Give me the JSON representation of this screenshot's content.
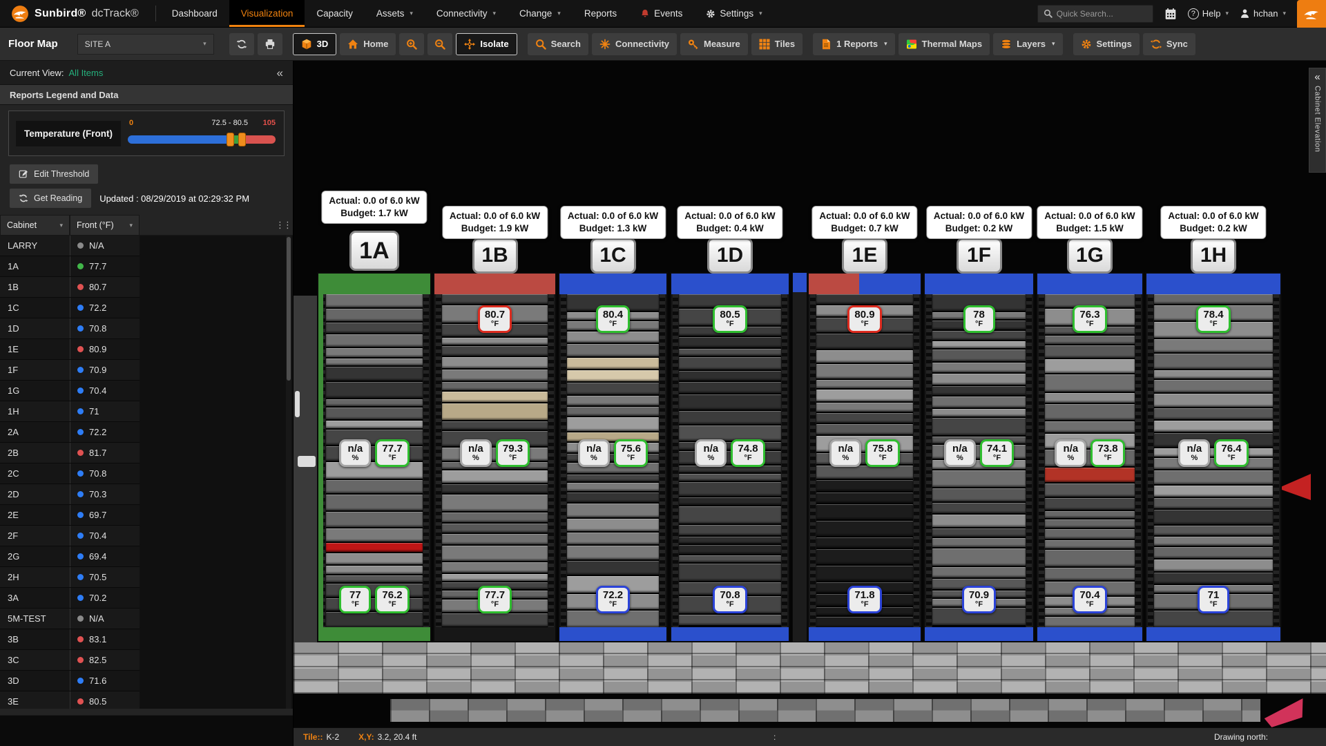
{
  "navbar": {
    "brand": {
      "name": "Sunbird®",
      "product": "dcTrack®"
    },
    "items": [
      {
        "label": "Dashboard"
      },
      {
        "label": "Visualization",
        "active": true
      },
      {
        "label": "Capacity"
      },
      {
        "label": "Assets",
        "dropdown": true
      },
      {
        "label": "Connectivity",
        "dropdown": true
      },
      {
        "label": "Change",
        "dropdown": true
      },
      {
        "label": "Reports"
      },
      {
        "label": "Events",
        "icon": "bell"
      },
      {
        "label": "Settings",
        "icon": "gear",
        "dropdown": true
      }
    ],
    "search_placeholder": "Quick Search...",
    "help_label": "Help",
    "user_name": "hchan"
  },
  "toolbar": {
    "title": "Floor Map",
    "site_selector": "SITE A",
    "buttons": [
      {
        "name": "refresh-button",
        "icon": "refresh",
        "icon_color": "#d8d8d8"
      },
      {
        "name": "print-button",
        "icon": "printer",
        "icon_color": "#d8d8d8"
      },
      {
        "name": "view-3d-button",
        "icon": "cube",
        "label": "3D",
        "outlined": true,
        "gap_before": true
      },
      {
        "name": "home-button",
        "icon": "home",
        "label": "Home"
      },
      {
        "name": "zoom-in-button",
        "icon": "zoom-in"
      },
      {
        "name": "zoom-out-button",
        "icon": "zoom-out"
      },
      {
        "name": "isolate-button",
        "icon": "isolate",
        "label": "Isolate",
        "outlined": true
      },
      {
        "name": "search-button",
        "icon": "search",
        "label": "Search",
        "gap_before": true
      },
      {
        "name": "connectivity-button",
        "icon": "connectivity",
        "label": "Connectivity"
      },
      {
        "name": "measure-button",
        "icon": "measure",
        "label": "Measure"
      },
      {
        "name": "tiles-button",
        "icon": "tiles",
        "label": "Tiles"
      },
      {
        "name": "reports-button",
        "icon": "report",
        "label": "1 Reports",
        "dropdown": true,
        "gap_before": true
      },
      {
        "name": "thermal-maps-button",
        "icon": "thermal",
        "label": "Thermal Maps"
      },
      {
        "name": "layers-button",
        "icon": "layers",
        "label": "Layers",
        "dropdown": true
      },
      {
        "name": "settings-button",
        "icon": "gear",
        "label": "Settings",
        "gap_before": true
      },
      {
        "name": "sync-button",
        "icon": "sync",
        "label": "Sync"
      }
    ]
  },
  "sidebar": {
    "current_view_label": "Current View:",
    "current_view_value": "All Items",
    "legend_header": "Reports Legend and Data",
    "legend": {
      "metric_label": "Temperature (Front)",
      "min": "0",
      "max": "105",
      "range": "72.5 - 80.5",
      "low_pct": 69,
      "mid_pct": 77,
      "colors": {
        "low": "#2d6fd9",
        "mid": "#3da03d",
        "high": "#d9534f",
        "handle": "#ef8d1d"
      }
    },
    "edit_threshold_label": "Edit Threshold",
    "get_reading_label": "Get Reading",
    "updated_text": "Updated : 08/29/2019 at 02:29:32 PM",
    "table": {
      "columns": [
        "Cabinet",
        "Front (°F)"
      ],
      "rows": [
        {
          "cabinet": "LARRY",
          "value": "N/A",
          "status": "na"
        },
        {
          "cabinet": "1A",
          "value": "77.7",
          "status": "ok"
        },
        {
          "cabinet": "1B",
          "value": "80.7",
          "status": "hot"
        },
        {
          "cabinet": "1C",
          "value": "72.2",
          "status": "cold"
        },
        {
          "cabinet": "1D",
          "value": "70.8",
          "status": "cold"
        },
        {
          "cabinet": "1E",
          "value": "80.9",
          "status": "hot"
        },
        {
          "cabinet": "1F",
          "value": "70.9",
          "status": "cold"
        },
        {
          "cabinet": "1G",
          "value": "70.4",
          "status": "cold"
        },
        {
          "cabinet": "1H",
          "value": "71",
          "status": "cold"
        },
        {
          "cabinet": "2A",
          "value": "72.2",
          "status": "cold"
        },
        {
          "cabinet": "2B",
          "value": "81.7",
          "status": "hot"
        },
        {
          "cabinet": "2C",
          "value": "70.8",
          "status": "cold"
        },
        {
          "cabinet": "2D",
          "value": "70.3",
          "status": "cold"
        },
        {
          "cabinet": "2E",
          "value": "69.7",
          "status": "cold"
        },
        {
          "cabinet": "2F",
          "value": "70.4",
          "status": "cold"
        },
        {
          "cabinet": "2G",
          "value": "69.4",
          "status": "cold"
        },
        {
          "cabinet": "2H",
          "value": "70.5",
          "status": "cold"
        },
        {
          "cabinet": "3A",
          "value": "70.2",
          "status": "cold"
        },
        {
          "cabinet": "5M-TEST",
          "value": "N/A",
          "status": "na"
        },
        {
          "cabinet": "3B",
          "value": "83.1",
          "status": "hot"
        },
        {
          "cabinet": "3C",
          "value": "82.5",
          "status": "hot"
        },
        {
          "cabinet": "3D",
          "value": "71.6",
          "status": "cold"
        },
        {
          "cabinet": "3E",
          "value": "80.5",
          "status": "hot"
        }
      ]
    }
  },
  "main": {
    "status_colors": {
      "ok": "#2fbe2f",
      "hot": "#dd2c20",
      "cold": "#2b43d8",
      "na": "#a8a8a8"
    },
    "dot_colors": {
      "ok": "#41b649",
      "hot": "#e05252",
      "cold": "#2e7df6",
      "na": "#8a8a8a"
    },
    "racks": [
      {
        "id": "1A",
        "actual_label": "Actual: 0.0 of 6.0 kW",
        "budget_label": "Budget: 1.7 kW",
        "accent_top": [
          "#3e8c38"
        ],
        "accent_bottom": "#3e8c38",
        "accent_side": "#3e8c38",
        "badges": {
          "top": [],
          "mid": [
            {
              "value": "n/a",
              "unit": "%",
              "status": "na"
            },
            {
              "value": "77.7",
              "unit": "°F",
              "status": "ok"
            }
          ],
          "bottom": [
            {
              "value": "77",
              "unit": "°F",
              "status": "ok"
            },
            {
              "value": "76.2",
              "unit": "°F",
              "status": "ok"
            }
          ]
        }
      },
      {
        "id": "1B",
        "actual_label": "Actual: 0.0 of 6.0 kW",
        "budget_label": "Budget: 1.9 kW",
        "accent_top": [
          "#bb4a42"
        ],
        "accent_bottom": null,
        "accent_side": null,
        "badges": {
          "top": [
            {
              "value": "80.7",
              "unit": "°F",
              "status": "hot"
            }
          ],
          "mid": [
            {
              "value": "n/a",
              "unit": "%",
              "status": "na"
            },
            {
              "value": "79.3",
              "unit": "°F",
              "status": "ok"
            }
          ],
          "bottom": [
            {
              "value": "77.7",
              "unit": "°F",
              "status": "ok"
            }
          ]
        }
      },
      {
        "id": "1C",
        "actual_label": "Actual: 0.0 of 6.0 kW",
        "budget_label": "Budget: 1.3 kW",
        "accent_top": [
          "#2b50cc"
        ],
        "accent_bottom": "#2b50cc",
        "accent_side": null,
        "badges": {
          "top": [
            {
              "value": "80.4",
              "unit": "°F",
              "status": "ok"
            }
          ],
          "mid": [
            {
              "value": "n/a",
              "unit": "%",
              "status": "na"
            },
            {
              "value": "75.6",
              "unit": "°F",
              "status": "ok"
            }
          ],
          "bottom": [
            {
              "value": "72.2",
              "unit": "°F",
              "status": "cold"
            }
          ]
        }
      },
      {
        "id": "1D",
        "actual_label": "Actual: 0.0 of 6.0 kW",
        "budget_label": "Budget: 0.4 kW",
        "accent_top": [
          "#2b50cc"
        ],
        "accent_bottom": "#2b50cc",
        "accent_side": null,
        "badges": {
          "top": [
            {
              "value": "80.5",
              "unit": "°F",
              "status": "ok"
            }
          ],
          "mid": [
            {
              "value": "n/a",
              "unit": "%",
              "status": "na"
            },
            {
              "value": "74.8",
              "unit": "°F",
              "status": "ok"
            }
          ],
          "bottom": [
            {
              "value": "70.8",
              "unit": "°F",
              "status": "cold"
            }
          ]
        }
      },
      {
        "id": "1E",
        "actual_label": "Actual: 0.0 of 6.0 kW",
        "budget_label": "Budget: 0.7 kW",
        "accent_top": [
          "#bb4a42",
          "#2b50cc"
        ],
        "accent_bottom": "#2b50cc",
        "accent_side": null,
        "badges": {
          "top": [
            {
              "value": "80.9",
              "unit": "°F",
              "status": "hot"
            }
          ],
          "mid": [
            {
              "value": "n/a",
              "unit": "%",
              "status": "na"
            },
            {
              "value": "75.8",
              "unit": "°F",
              "status": "ok"
            }
          ],
          "bottom": [
            {
              "value": "71.8",
              "unit": "°F",
              "status": "cold"
            }
          ]
        }
      },
      {
        "id": "1F",
        "actual_label": "Actual: 0.0 of 6.0 kW",
        "budget_label": "Budget: 0.2 kW",
        "accent_top": [
          "#2b50cc"
        ],
        "accent_bottom": "#2b50cc",
        "accent_side": null,
        "badges": {
          "top": [
            {
              "value": "78",
              "unit": "°F",
              "status": "ok"
            }
          ],
          "mid": [
            {
              "value": "n/a",
              "unit": "%",
              "status": "na"
            },
            {
              "value": "74.1",
              "unit": "°F",
              "status": "ok"
            }
          ],
          "bottom": [
            {
              "value": "70.9",
              "unit": "°F",
              "status": "cold"
            }
          ]
        }
      },
      {
        "id": "1G",
        "actual_label": "Actual: 0.0 of 6.0 kW",
        "budget_label": "Budget: 1.5 kW",
        "accent_top": [
          "#2b50cc"
        ],
        "accent_bottom": "#2b50cc",
        "accent_side": null,
        "badges": {
          "top": [
            {
              "value": "76.3",
              "unit": "°F",
              "status": "ok"
            }
          ],
          "mid": [
            {
              "value": "n/a",
              "unit": "%",
              "status": "na"
            },
            {
              "value": "73.8",
              "unit": "°F",
              "status": "ok"
            }
          ],
          "bottom": [
            {
              "value": "70.4",
              "unit": "°F",
              "status": "cold"
            }
          ]
        }
      },
      {
        "id": "1H",
        "actual_label": "Actual: 0.0 of 6.0 kW",
        "budget_label": "Budget: 0.2 kW",
        "accent_top": [
          "#2b50cc"
        ],
        "accent_bottom": "#2b50cc",
        "accent_side": null,
        "badges": {
          "top": [
            {
              "value": "78.4",
              "unit": "°F",
              "status": "ok"
            }
          ],
          "mid": [
            {
              "value": "n/a",
              "unit": "%",
              "status": "na"
            },
            {
              "value": "76.4",
              "unit": "°F",
              "status": "ok"
            }
          ],
          "bottom": [
            {
              "value": "71",
              "unit": "°F",
              "status": "cold"
            }
          ]
        }
      }
    ]
  },
  "statusbar": {
    "tile_label": "Tile::",
    "tile_value": "K-2",
    "xy_label": "X,Y:",
    "xy_value": "3.2, 20.4 ft",
    "sep": ":",
    "north_label": "Drawing north:"
  },
  "right_tab": {
    "label": "Cabinet Elevation"
  }
}
